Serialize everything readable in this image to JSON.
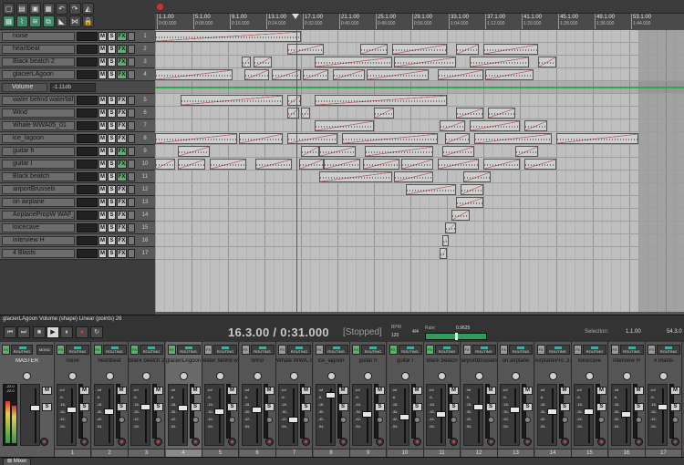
{
  "toolbar": {
    "buttons": [
      {
        "name": "new-project-icon",
        "glyph": "▢",
        "on": false
      },
      {
        "name": "open-project-icon",
        "glyph": "▤",
        "on": false
      },
      {
        "name": "save-project-icon",
        "glyph": "▣",
        "on": false
      },
      {
        "name": "project-settings-icon",
        "glyph": "▦",
        "on": false
      },
      {
        "name": "undo-icon",
        "glyph": "↶",
        "on": false
      },
      {
        "name": "redo-icon",
        "glyph": "↷",
        "on": false
      },
      {
        "name": "metronome-icon",
        "glyph": "◭",
        "on": false
      },
      {
        "name": "grid-icon",
        "glyph": "▦",
        "on": true
      },
      {
        "name": "snap-icon",
        "glyph": "⌇",
        "on": true
      },
      {
        "name": "ripple-icon",
        "glyph": "≋",
        "on": true
      },
      {
        "name": "item-grouping-icon",
        "glyph": "⧉",
        "on": true
      },
      {
        "name": "envelope-lock-icon",
        "glyph": "◣",
        "on": false
      },
      {
        "name": "crossfade-icon",
        "glyph": "⋈",
        "on": false
      },
      {
        "name": "lock-icon",
        "glyph": "🔒",
        "on": false
      }
    ]
  },
  "ruler": {
    "bars": [
      {
        "bar": "1.1.00",
        "time": "0:00.000"
      },
      {
        "bar": "5.1.00",
        "time": "0:08.000"
      },
      {
        "bar": "9.1.00",
        "time": "0:16.000"
      },
      {
        "bar": "13.1.00",
        "time": "0:24.000"
      },
      {
        "bar": "17.1.00",
        "time": "0:32.000"
      },
      {
        "bar": "21.1.00",
        "time": "0:40.000"
      },
      {
        "bar": "25.1.00",
        "time": "0:48.000"
      },
      {
        "bar": "29.1.00",
        "time": "0:56.000"
      },
      {
        "bar": "33.1.00",
        "time": "1:04.000"
      },
      {
        "bar": "37.1.00",
        "time": "1:12.000"
      },
      {
        "bar": "41.1.00",
        "time": "1:20.000"
      },
      {
        "bar": "45.1.00",
        "time": "1:28.000"
      },
      {
        "bar": "49.1.00",
        "time": "1:36.000"
      },
      {
        "bar": "53.1.00",
        "time": "1:44.000"
      }
    ]
  },
  "tracks": [
    {
      "name": "noise",
      "num": "1",
      "fx_on": true,
      "items": [
        [
          0,
          160
        ]
      ]
    },
    {
      "name": "heartbeat",
      "num": "2",
      "fx_on": true,
      "items": [
        [
          145,
          185
        ],
        [
          225,
          255
        ],
        [
          260,
          320
        ],
        [
          330,
          355
        ],
        [
          360,
          420
        ]
      ]
    },
    {
      "name": "Black beatch 2",
      "num": "3",
      "fx_on": true,
      "items": [
        [
          95,
          105
        ],
        [
          108,
          128
        ],
        [
          175,
          260
        ],
        [
          262,
          330
        ],
        [
          345,
          410
        ],
        [
          420,
          440
        ]
      ]
    },
    {
      "name": "glacierLAgoon",
      "num": "4",
      "fx_on": true,
      "items": [
        [
          0,
          85
        ],
        [
          98,
          125
        ],
        [
          128,
          160
        ],
        [
          162,
          190
        ],
        [
          195,
          230
        ],
        [
          232,
          300
        ],
        [
          310,
          360
        ],
        [
          362,
          415
        ]
      ]
    },
    {
      "name": "Volume",
      "num": "",
      "fx_on": false,
      "envelope": true,
      "value": "-1.11db",
      "items": []
    },
    {
      "name": "water befind waterfall",
      "num": "5",
      "fx_on": false,
      "items": [
        [
          28,
          140
        ],
        [
          145,
          160
        ],
        [
          175,
          320
        ]
      ]
    },
    {
      "name": "Wind",
      "num": "6",
      "fx_on": false,
      "items": [
        [
          145,
          158
        ],
        [
          160,
          170
        ],
        [
          240,
          262
        ],
        [
          330,
          360
        ],
        [
          365,
          395
        ]
      ]
    },
    {
      "name": "Whale WWA05_01",
      "num": "7",
      "fx_on": false,
      "items": [
        [
          175,
          240
        ],
        [
          312,
          340
        ],
        [
          345,
          400
        ],
        [
          405,
          430
        ]
      ]
    },
    {
      "name": "ice_lagoon",
      "num": "8",
      "fx_on": false,
      "items": [
        [
          0,
          90
        ],
        [
          92,
          140
        ],
        [
          145,
          200
        ],
        [
          205,
          310
        ],
        [
          318,
          345
        ],
        [
          350,
          435
        ],
        [
          440,
          530
        ]
      ]
    },
    {
      "name": "guitar h",
      "num": "9",
      "fx_on": true,
      "items": [
        [
          25,
          60
        ],
        [
          160,
          180
        ],
        [
          180,
          220
        ],
        [
          230,
          305
        ],
        [
          315,
          350
        ],
        [
          395,
          420
        ]
      ]
    },
    {
      "name": "guitar l",
      "num": "10",
      "fx_on": true,
      "items": [
        [
          0,
          22
        ],
        [
          25,
          55
        ],
        [
          60,
          100
        ],
        [
          110,
          150
        ],
        [
          158,
          185
        ],
        [
          185,
          225
        ],
        [
          228,
          268
        ],
        [
          270,
          305
        ],
        [
          310,
          355
        ],
        [
          360,
          400
        ],
        [
          405,
          440
        ]
      ]
    },
    {
      "name": "Black beatch",
      "num": "11",
      "fx_on": true,
      "items": [
        [
          180,
          260
        ],
        [
          262,
          305
        ],
        [
          338,
          368
        ]
      ]
    },
    {
      "name": "airportBrussels",
      "num": "12",
      "fx_on": false,
      "items": [
        [
          275,
          330
        ],
        [
          335,
          360
        ]
      ]
    },
    {
      "name": "on airplane",
      "num": "13",
      "fx_on": false,
      "items": [
        [
          330,
          360
        ]
      ]
    },
    {
      "name": "AirplanePropW WAF_31",
      "num": "14",
      "fx_on": false,
      "items": [
        [
          325,
          345
        ]
      ]
    },
    {
      "name": "loicecave",
      "num": "15",
      "fx_on": false,
      "items": [
        [
          318,
          330
        ]
      ]
    },
    {
      "name": "interview H",
      "num": "16",
      "fx_on": false,
      "items": [
        [
          315,
          322
        ]
      ]
    },
    {
      "name": "4 Blasts",
      "num": "17",
      "fx_on": false,
      "items": [
        [
          312,
          320
        ]
      ]
    }
  ],
  "transport": {
    "selection_info": "glacierLAgoon Volume (shape) Linear (points) 26",
    "position": "16.3.00 / 0:31.000",
    "state": "[Stopped]",
    "bpm_label": "BPM",
    "bpm": "120",
    "time_sig": "4/4",
    "rate_label": "Rate:",
    "rate": "0.9625",
    "rate_fraction": 0.48,
    "selection_label": "Selection:",
    "selection_start": "1.1.00",
    "selection_end": "54.3.0",
    "buttons": [
      {
        "name": "go-to-start-button",
        "glyph": "⏮"
      },
      {
        "name": "go-to-end-button",
        "glyph": "⏭"
      },
      {
        "name": "stop-button",
        "glyph": "■"
      },
      {
        "name": "play-button",
        "glyph": "▶"
      },
      {
        "name": "pause-button",
        "glyph": "⏸"
      },
      {
        "name": "record-button",
        "glyph": "●"
      },
      {
        "name": "repeat-button",
        "glyph": "↻"
      }
    ]
  },
  "mixer": {
    "master": {
      "name": "MASTER",
      "mono_label": "MONO",
      "fx_label": "FX",
      "routing_label": "ROUTING",
      "readout": "-22.0 -22.0",
      "left_level": 0.72,
      "right_level": 0.64
    },
    "fx_label": "FX",
    "routing_label": "ROUTING",
    "mute_label": "M",
    "solo_label": "S",
    "scale": [
      "-inf",
      "-6-",
      "-18-",
      "-30-",
      "-42-",
      "-54-"
    ],
    "strips": [
      {
        "name": "noise",
        "num": "1",
        "fx_on": true,
        "fader": 0.35,
        "selected": false
      },
      {
        "name": "heartbeat",
        "num": "2",
        "fx_on": true,
        "fader": 0.4,
        "selected": false
      },
      {
        "name": "Black beatch 2",
        "num": "3",
        "fx_on": true,
        "fader": 0.3,
        "selected": false
      },
      {
        "name": "glacierLAgoon",
        "num": "4",
        "fx_on": true,
        "fader": 0.33,
        "selected": true
      },
      {
        "name": "water befind wa",
        "num": "5",
        "fx_on": false,
        "fader": 0.4,
        "selected": false
      },
      {
        "name": "Wind",
        "num": "6",
        "fx_on": false,
        "fader": 0.35,
        "selected": false
      },
      {
        "name": "Whale WWA..01",
        "num": "7",
        "fx_on": false,
        "fader": 0.55,
        "selected": false
      },
      {
        "name": "ice_lagoon",
        "num": "8",
        "fx_on": false,
        "fader": 0.07,
        "selected": false
      },
      {
        "name": "guitar h",
        "num": "9",
        "fx_on": true,
        "fader": 0.45,
        "selected": false
      },
      {
        "name": "guitar l",
        "num": "10",
        "fx_on": true,
        "fader": 0.5,
        "selected": false
      },
      {
        "name": "Black beatch",
        "num": "11",
        "fx_on": true,
        "fader": 0.45,
        "selected": false
      },
      {
        "name": "airportBrussels",
        "num": "12",
        "fx_on": false,
        "fader": 0.3,
        "selected": false
      },
      {
        "name": "on airplane",
        "num": "13",
        "fx_on": false,
        "fader": 0.35,
        "selected": false
      },
      {
        "name": "AirplanePro..31",
        "num": "14",
        "fx_on": false,
        "fader": 0.4,
        "selected": false
      },
      {
        "name": "loicecave",
        "num": "15",
        "fx_on": false,
        "fader": 0.4,
        "selected": false
      },
      {
        "name": "interview H",
        "num": "16",
        "fx_on": false,
        "fader": 0.45,
        "selected": false
      },
      {
        "name": "4 Blasts",
        "num": "17",
        "fx_on": false,
        "fader": 0.3,
        "selected": false
      }
    ]
  },
  "bottom_bar": {
    "tab_label": "Mixer"
  },
  "colors": {
    "accent_green": "#2fa84f",
    "cursor_red": "#d22222",
    "fx_green": "#5ab36a"
  }
}
